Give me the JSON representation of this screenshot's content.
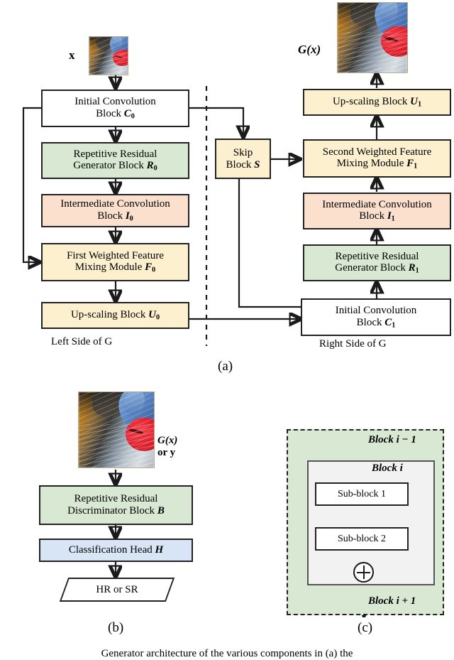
{
  "figure": {
    "panels": [
      {
        "id": "a",
        "label": "(a)"
      },
      {
        "id": "b",
        "label": "(b)"
      },
      {
        "id": "c",
        "label": "(c)"
      }
    ],
    "caption_partial": "Generator architecture of the various components in (a) the"
  },
  "panel_a": {
    "input_label": "x",
    "output_label": "G(x)",
    "left_caption": "Left Side of G",
    "right_caption": "Right Side of G",
    "left_blocks": [
      {
        "name": "initial-convolution-block-c0",
        "line1": "Initial Convolution",
        "line2": "Block",
        "symbol": "C",
        "sub": "0",
        "color": "white"
      },
      {
        "name": "repetitive-residual-generator-block-r0",
        "line1": "Repetitive Residual",
        "line2": "Generator Block",
        "symbol": "R",
        "sub": "0",
        "color": "green"
      },
      {
        "name": "intermediate-convolution-block-i0",
        "line1": "Intermediate Convolution",
        "line2": "Block",
        "symbol": "I",
        "sub": "0",
        "color": "orange"
      },
      {
        "name": "first-weighted-feature-mixing-module-f0",
        "line1": "First Weighted Feature",
        "line2": "Mixing Module",
        "symbol": "F",
        "sub": "0",
        "color": "cream"
      },
      {
        "name": "up-scaling-block-u0",
        "line1": "Up-scaling Block",
        "line2": "",
        "symbol": "U",
        "sub": "0",
        "color": "cream"
      }
    ],
    "skip_block": {
      "name": "skip-block-s",
      "line1": "Skip",
      "line2": "Block",
      "symbol": "S",
      "sub": "",
      "color": "cream"
    },
    "right_blocks": [
      {
        "name": "up-scaling-block-u1",
        "line1": "Up-scaling Block",
        "line2": "",
        "symbol": "U",
        "sub": "1",
        "color": "cream"
      },
      {
        "name": "second-weighted-feature-mixing-module-f1",
        "line1": "Second Weighted Feature",
        "line2": "Mixing Module",
        "symbol": "F",
        "sub": "1",
        "color": "cream"
      },
      {
        "name": "intermediate-convolution-block-i1",
        "line1": "Intermediate Convolution",
        "line2": "Block",
        "symbol": "I",
        "sub": "1",
        "color": "orange"
      },
      {
        "name": "repetitive-residual-generator-block-r1",
        "line1": "Repetitive Residual",
        "line2": "Generator Block",
        "symbol": "R",
        "sub": "1",
        "color": "green"
      },
      {
        "name": "initial-convolution-block-c1",
        "line1": "Initial Convolution",
        "line2": "Block",
        "symbol": "C",
        "sub": "1",
        "color": "white"
      }
    ]
  },
  "panel_b": {
    "input_label_line1": "G(x)",
    "input_label_line2": "or y",
    "blocks": [
      {
        "name": "repetitive-residual-discriminator-block-b",
        "line1": "Repetitive Residual",
        "line2": "Discriminator Block",
        "symbol": "B",
        "sub": "",
        "color": "green"
      },
      {
        "name": "classification-head-h",
        "line1": "Classification Head",
        "line2": "",
        "symbol": "H",
        "sub": "",
        "color": "blue"
      }
    ],
    "output": {
      "name": "output-hr-or-sr",
      "text": "HR or SR"
    }
  },
  "panel_c": {
    "outer_label": "Block i − 1",
    "inner_label": "Block i",
    "bottom_label": "Block i + 1",
    "sub_blocks": [
      {
        "name": "sub-block-1",
        "text": "Sub-block 1"
      },
      {
        "name": "sub-block-2",
        "text": "Sub-block 2"
      }
    ],
    "adder": "⊕"
  },
  "colors": {
    "green": "#d9e8d3",
    "orange": "#fbe0cd",
    "cream": "#fcf0cf",
    "blue": "#d8e5f6",
    "white": "#ffffff",
    "stroke": "#1a1a1a"
  }
}
